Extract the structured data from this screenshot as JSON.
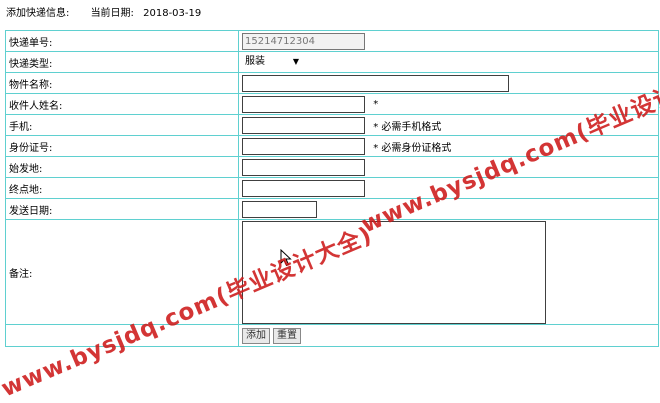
{
  "header": {
    "title": "添加快递信息:",
    "date_label": "当前日期:",
    "date_value": "2018-03-19"
  },
  "form": {
    "tracking_no": {
      "label": "快递单号:",
      "value": "15214712304"
    },
    "type": {
      "label": "快递类型:",
      "value": "服装"
    },
    "item_name": {
      "label": "物件名称:"
    },
    "recipient": {
      "label": "收件人姓名:",
      "hint": "*"
    },
    "phone": {
      "label": "手机:",
      "hint": "* 必需手机格式"
    },
    "id_card": {
      "label": "身份证号:",
      "hint": "* 必需身份证格式"
    },
    "origin": {
      "label": "始发地:"
    },
    "destination": {
      "label": "终点地:"
    },
    "send_date": {
      "label": "发送日期:"
    },
    "note": {
      "label": "备注:"
    }
  },
  "buttons": {
    "add": "添加",
    "reset": "重置"
  },
  "watermark": {
    "text_a": "www.bysjdq.com(毕业设计大全)",
    "text_b": "www.bysjdq.com(毕业设计大全)",
    "color": "#cc1a1a"
  },
  "colors": {
    "table_border": "#5fd0d0"
  }
}
